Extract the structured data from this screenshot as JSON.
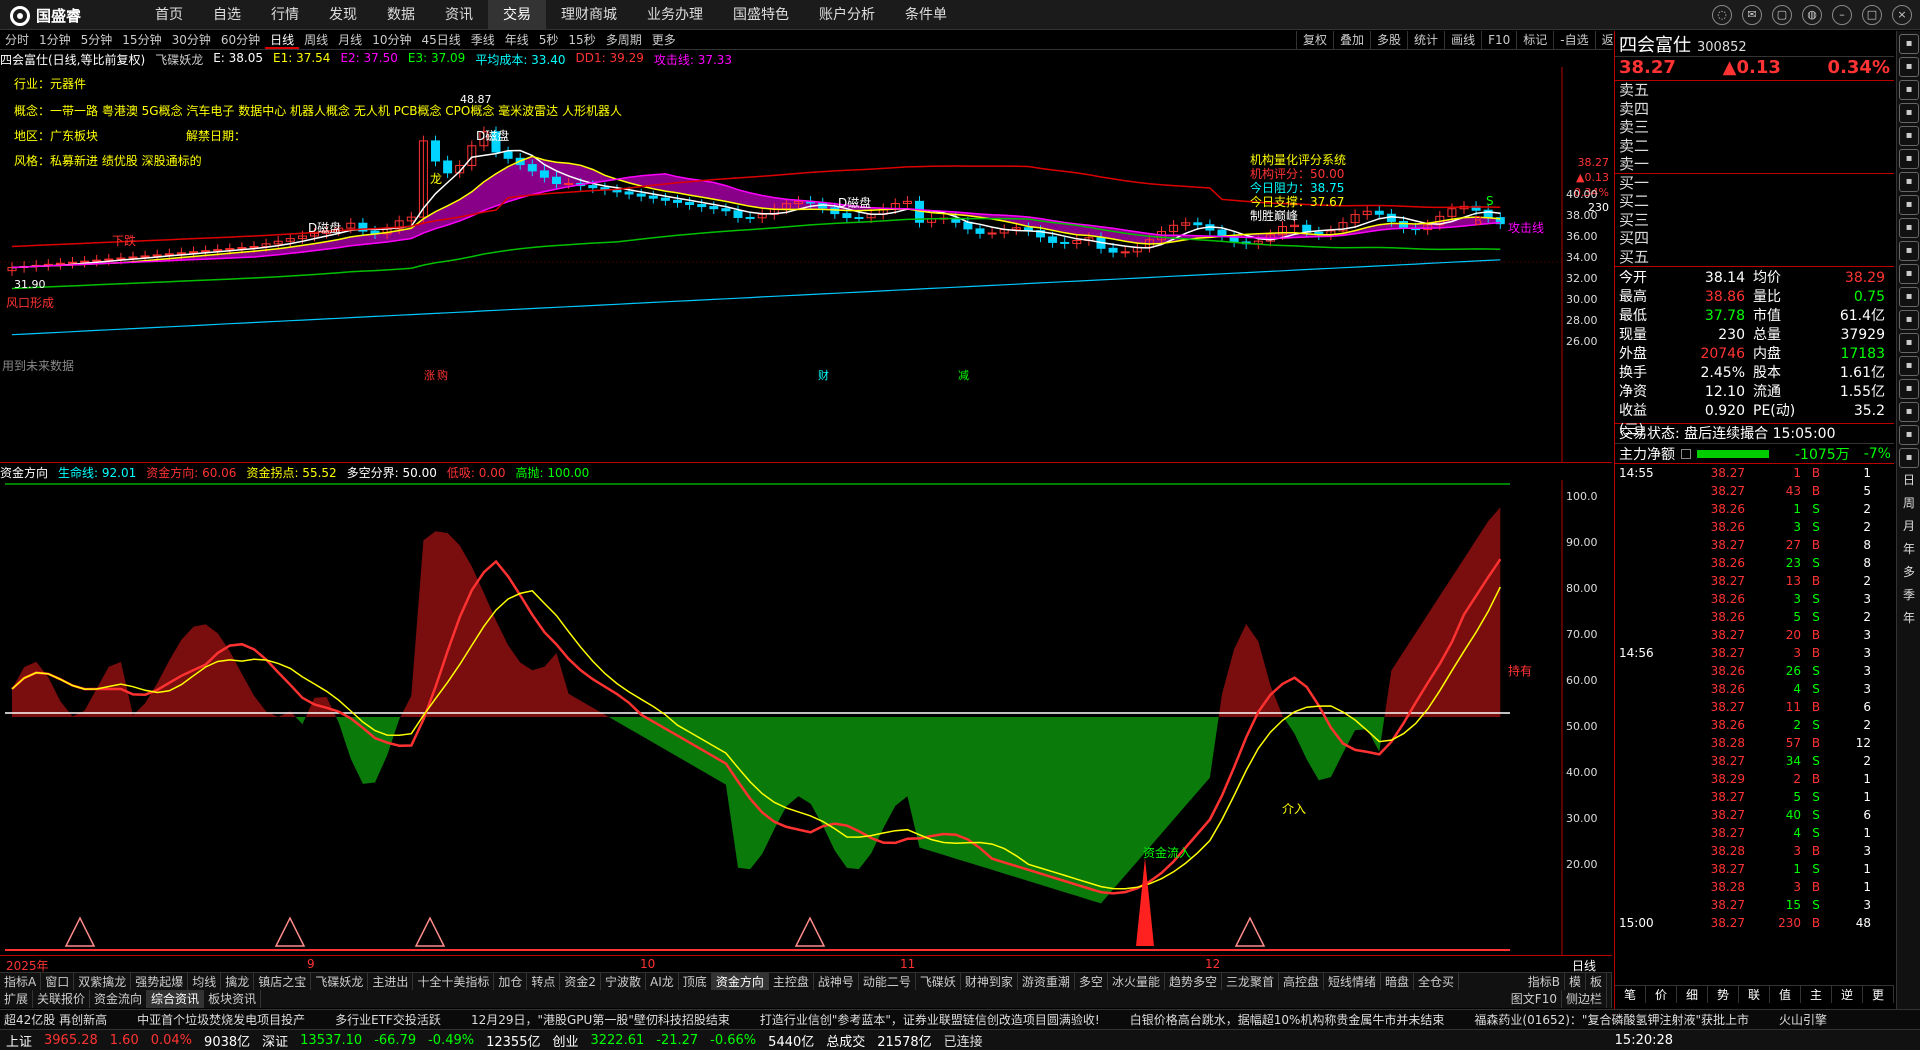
{
  "app": {
    "brand": "国盛睿",
    "nav": [
      "首页",
      "自选",
      "行情",
      "发现",
      "数据",
      "资讯",
      "交易",
      "理财商城",
      "业务办理",
      "国盛特色",
      "账户分析",
      "条件单"
    ],
    "active_nav": "交易"
  },
  "periods": [
    "分时",
    "1分钟",
    "5分钟",
    "15分钟",
    "30分钟",
    "60分钟",
    "日线",
    "周线",
    "月线",
    "10分钟",
    "45日线",
    "季线",
    "年线",
    "5秒",
    "15秒",
    "多周期",
    "更多"
  ],
  "active_period": "日线",
  "toolbar_right": [
    "复权",
    "叠加",
    "多股",
    "统计",
    "画线",
    "F10",
    "标记",
    "-自选",
    "返回"
  ],
  "main_info": {
    "title": "四会富仕(日线,等比前复权)",
    "ind_name": "飞碟妖龙",
    "E": "E: 38.05",
    "E1": "E1: 37.54",
    "E2": "E2: 37.50",
    "E3": "E3: 37.09",
    "avg": "平均成本: 33.40",
    "DD1": "DD1: 39.29",
    "attack": "攻击线: 37.33"
  },
  "tags": {
    "industry": "行业：元器件",
    "concept": "概念：一带一路 粤港澳 5G概念 汽车电子 数据中心 机器人概念 无人机 PCB概念 CPO概念 毫米波雷达 人形机器人",
    "region": "地区：广东板块",
    "unlock": "解禁日期：",
    "style": "风格：私募新进 绩优股 深股通标的"
  },
  "annot": {
    "high": "48.87",
    "low": "31.90",
    "dmp1": "D磁盘",
    "dmp2": "D磁盘",
    "dmp3": "D磁盘",
    "fengkou": "风口形成",
    "xiadie": "下跌",
    "long": "龙",
    "attack_line": "攻击线",
    "s_mark": "S",
    "b_mark": "B",
    "sim": "用到未来数据",
    "events": [
      "涨",
      "财",
      "减"
    ],
    "event2": "购"
  },
  "score": {
    "title": "机构量化评分系统",
    "score": "机构评分：50.00",
    "resist": "今日阻力：38.75",
    "support": "今日支撑：37.67",
    "strategy": "制胜巅峰"
  },
  "price_panel": {
    "cur": "38.27",
    "chg": "▲0.13",
    "pct": "0.34%",
    "vol": "230"
  },
  "main_yaxis": [
    "40.00",
    "38.00",
    "36.00",
    "34.00",
    "32.00",
    "30.00",
    "28.00",
    "26.00"
  ],
  "sub_info": {
    "name": "资金方向",
    "life": "生命线: 92.01",
    "dir": "资金方向: 60.06",
    "turn": "资金拐点: 55.52",
    "split": "多空分界: 50.00",
    "low": "低吸: 0.00",
    "high": "高抛: 100.00"
  },
  "sub_yaxis": [
    "100.0",
    "90.00",
    "80.00",
    "70.00",
    "60.00",
    "50.00",
    "40.00",
    "30.00",
    "20.00"
  ],
  "sub_annot": {
    "inflow": "资金流入",
    "jieru": "介入",
    "hold": "持有"
  },
  "dates": [
    "2025年",
    "9",
    "10",
    "11",
    "12"
  ],
  "bottom_label": "日线",
  "btabs": [
    "指标A",
    "窗口",
    "双紫擒龙",
    "强势起爆",
    "均线",
    "擒龙",
    "镇店之宝",
    "飞碟妖龙",
    "主进出",
    "十全十美指标",
    "加仓",
    "转点",
    "资金2",
    "宁波散",
    "AI龙",
    "顶底",
    "资金方向",
    "主控盘",
    "战神号",
    "动能二号",
    "飞碟妖",
    "财神到家",
    "游资重潮",
    "多空",
    "冰火量能",
    "趋势多空",
    "三龙聚首",
    "高控盘",
    "短线情绪",
    "暗盘",
    "全仓买"
  ],
  "btabs_right": [
    "指标B",
    "模",
    "板"
  ],
  "btabs2": [
    "扩展",
    "关联报价",
    "资金流向",
    "综合资讯",
    "板块资讯"
  ],
  "btabs2_right": [
    "图文F10",
    "侧边栏"
  ],
  "sel_tab": "资金方向",
  "sel_tab2": "综合资讯",
  "ticker": [
    "超42亿股 再创新高",
    "中亚首个垃圾焚烧发电项目投产",
    "多行业ETF交投活跃",
    "12月29日，\"港股GPU第一股\"壁仞科技招股结束",
    "打造行业信创\"参考蓝本\"，证券业联盟链信创改造项目圆满验收!",
    "白银价格高台跳水，据幅超10%机构称贵金属牛市并未结束",
    "福森药业(01652)：\"复合磷酸氢钾注射液\"获批上市",
    "火山引擎"
  ],
  "status": {
    "sh": "上证",
    "sh_v": "3965.28",
    "sh_c": "1.60",
    "sh_p": "0.04%",
    "sh_a": "9038亿",
    "sz": "深证",
    "sz_v": "13537.10",
    "sz_c": "-66.79",
    "sz_p": "-0.49%",
    "sz_a": "12355亿",
    "cy": "创业",
    "cy_v": "3222.61",
    "cy_c": "-21.27",
    "cy_p": "-0.66%",
    "cy_a": "5440亿",
    "total": "总成交",
    "total_v": "21578亿",
    "conn": "已连接",
    "time": "15:20:28"
  },
  "right": {
    "name": "四会富仕",
    "code": "300852",
    "price": "38.27",
    "chg": "▲0.13",
    "pct": "0.34%",
    "orders": [
      "卖五",
      "卖四",
      "卖三",
      "卖二",
      "卖一",
      "买一",
      "买二",
      "买三",
      "买四",
      "买五"
    ],
    "quote": [
      [
        "今开",
        "38.14",
        "均价",
        "38.29"
      ],
      [
        "最高",
        "38.86",
        "量比",
        "0.75"
      ],
      [
        "最低",
        "37.78",
        "市值",
        "61.4亿"
      ],
      [
        "现量",
        "230",
        "总量",
        "37929"
      ],
      [
        "外盘",
        "20746",
        "内盘",
        "17183"
      ],
      [
        "换手",
        "2.45%",
        "股本",
        "1.61亿"
      ],
      [
        "净资",
        "12.10",
        "流通",
        "1.55亿"
      ],
      [
        "收益(三)",
        "0.920",
        "PE(动)",
        "35.2"
      ]
    ],
    "trade_state": "交易状态: 盘后连续撮合 15:05:00",
    "net_label": "主力净额",
    "net_val": "-1075万",
    "net_pct": "-7%",
    "time1": "14:55",
    "time2": "14:56",
    "time3": "15:00",
    "ticks": [
      [
        "38.27",
        "1",
        "B",
        "1"
      ],
      [
        "38.27",
        "43",
        "B",
        "5"
      ],
      [
        "38.26",
        "1",
        "S",
        "2"
      ],
      [
        "38.26",
        "3",
        "S",
        "2"
      ],
      [
        "38.27",
        "27",
        "B",
        "8"
      ],
      [
        "38.26",
        "23",
        "S",
        "8"
      ],
      [
        "38.27",
        "13",
        "B",
        "2"
      ],
      [
        "38.26",
        "3",
        "S",
        "3"
      ],
      [
        "38.26",
        "5",
        "S",
        "2"
      ],
      [
        "38.27",
        "20",
        "B",
        "3"
      ],
      [
        "38.27",
        "3",
        "B",
        "3"
      ],
      [
        "38.26",
        "26",
        "S",
        "3"
      ],
      [
        "38.26",
        "4",
        "S",
        "3"
      ],
      [
        "38.27",
        "11",
        "B",
        "6"
      ],
      [
        "38.26",
        "2",
        "S",
        "2"
      ],
      [
        "38.28",
        "57",
        "B",
        "12"
      ],
      [
        "38.27",
        "34",
        "S",
        "2"
      ],
      [
        "38.29",
        "2",
        "B",
        "1"
      ],
      [
        "38.27",
        "5",
        "S",
        "1"
      ],
      [
        "38.27",
        "40",
        "S",
        "6"
      ],
      [
        "38.27",
        "4",
        "S",
        "1"
      ],
      [
        "38.28",
        "3",
        "B",
        "3"
      ],
      [
        "38.27",
        "1",
        "S",
        "1"
      ],
      [
        "38.28",
        "3",
        "B",
        "1"
      ],
      [
        "38.27",
        "15",
        "S",
        "3"
      ],
      [
        "38.27",
        "230",
        "B",
        "48"
      ]
    ],
    "bottom_tabs": [
      "笔",
      "价",
      "细",
      "势",
      "联",
      "值",
      "主",
      "逆",
      "更"
    ]
  },
  "sidebar_icons": [
    "expand-icon",
    "list-icon",
    "grid-icon",
    "chart-icon",
    "note-icon",
    "pin-icon",
    "star-icon",
    "calendar-icon",
    "book-icon",
    "tool-icon",
    "news-icon",
    "bell-icon",
    "data-icon",
    "share-icon",
    "link-icon",
    "flag-icon",
    "rsi-icon",
    "search-icon",
    "doc-icon"
  ],
  "sidebar_periods": [
    "日",
    "周",
    "月",
    "年",
    "多",
    "季",
    "年"
  ],
  "colors": {
    "up": "#ff3232",
    "down": "#00d4ff",
    "yellow": "#ffff00",
    "magenta": "#a000a0",
    "green": "#00a000"
  }
}
